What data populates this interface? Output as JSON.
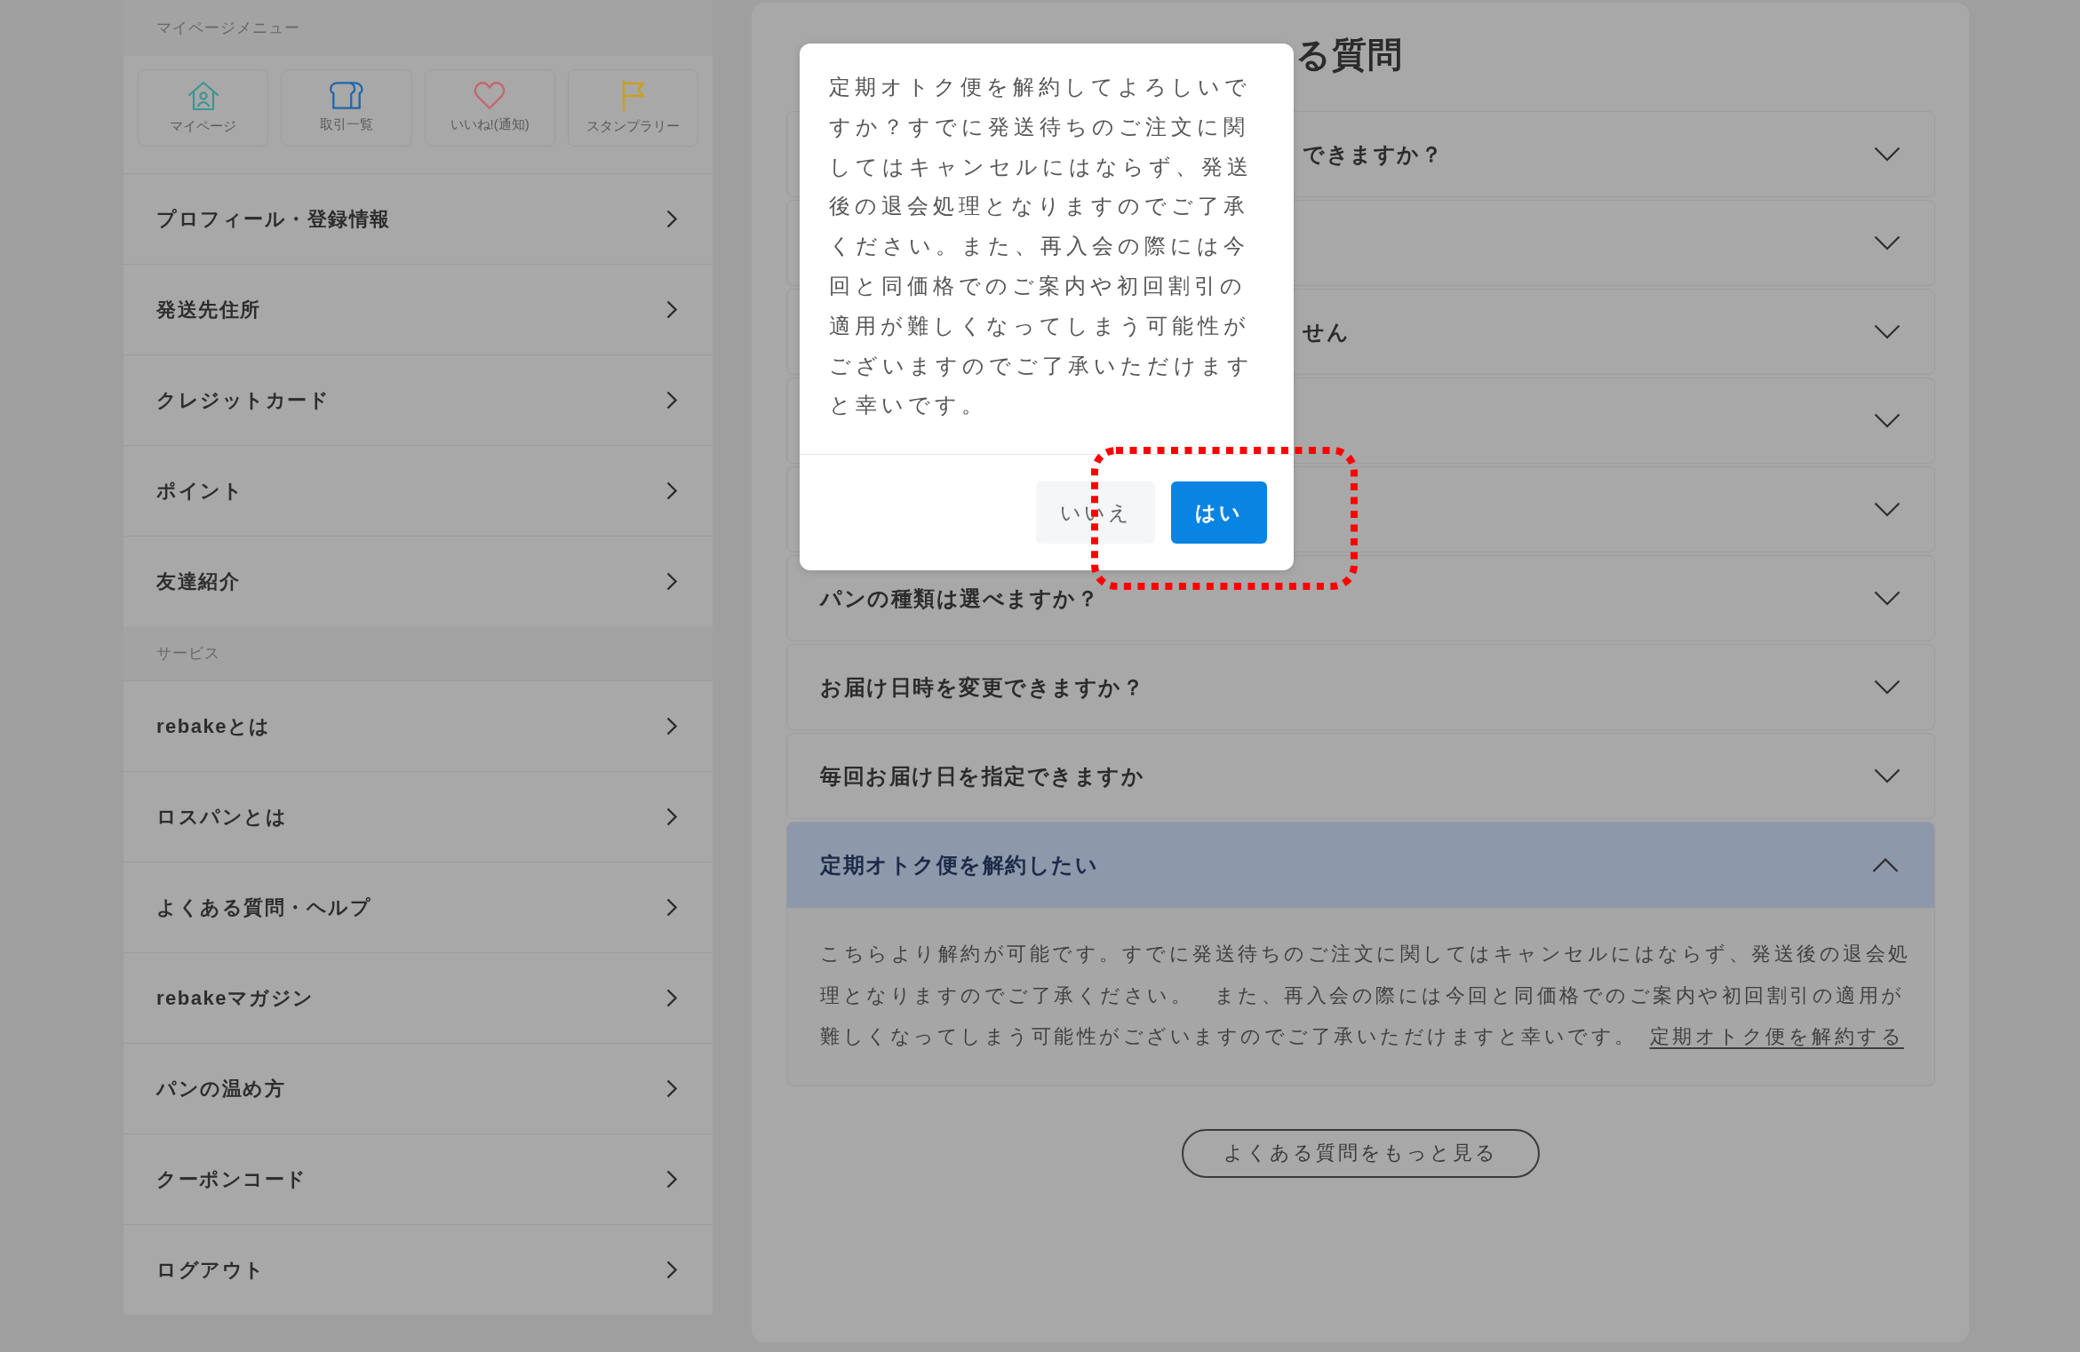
{
  "sidebar": {
    "sections": [
      {
        "label": "マイページメニュー",
        "tiles": [
          "マイページ",
          "取引一覧",
          "いいね!(通知)",
          "スタンプラリー"
        ],
        "items": [
          "プロフィール・登録情報",
          "発送先住所",
          "クレジットカード",
          "ポイント",
          "友達紹介"
        ]
      },
      {
        "label": "サービス",
        "items": [
          "rebakeとは",
          "ロスパンとは",
          "よくある質問・ヘルプ",
          "rebakeマガジン",
          "パンの温め方",
          "クーポンコード",
          "ログアウト"
        ]
      }
    ]
  },
  "faq": {
    "title": {
      "text": "る質問",
      "covered": true
    },
    "items": [
      {
        "question": "できますか？",
        "covered": true,
        "expanded": false
      },
      {
        "expanded": false
      },
      {
        "question": "せん",
        "covered": true,
        "expanded": false
      },
      {
        "expanded": false
      },
      {
        "expanded": false
      },
      {
        "question": "パンの種類は選べますか？",
        "covered": false,
        "expanded": false
      },
      {
        "question": "お届け日時を変更できますか？",
        "covered": false,
        "expanded": false
      },
      {
        "question": "毎回お届け日を指定できますか",
        "covered": false,
        "expanded": false
      },
      {
        "question": "定期オトク便を解約したい",
        "covered": false,
        "expanded": true,
        "answer": "こちらより解約が可能です。すでに発送待ちのご注文に関してはキャンセルにはならず、発送後の退会処理となりますのでご了承ください。 また、再入会の際には今回と同価格でのご案内や初回割引の適用が難しくなってしまう可能性がございますのでご了承いただけますと幸いです。",
        "link": "定期オトク便を解約する"
      }
    ],
    "more_button": "よくある質問をもっと見る"
  },
  "dialog": {
    "message": "定期オトク便を解約してよろしいですか？すでに発送待ちのご注文に関してはキャンセルにはならず、発送後の退会処理となりますのでご了承ください。また、再入会の際には今回と同価格でのご案内や初回割引の適用が難しくなってしまう可能性がございますのでご了承いただけますと幸いです。",
    "buttons": [
      {
        "label": "いいえ",
        "kind": "secondary"
      },
      {
        "label": "はい",
        "kind": "primary"
      }
    ]
  },
  "annotation": {
    "kind": "dotted-frame"
  }
}
